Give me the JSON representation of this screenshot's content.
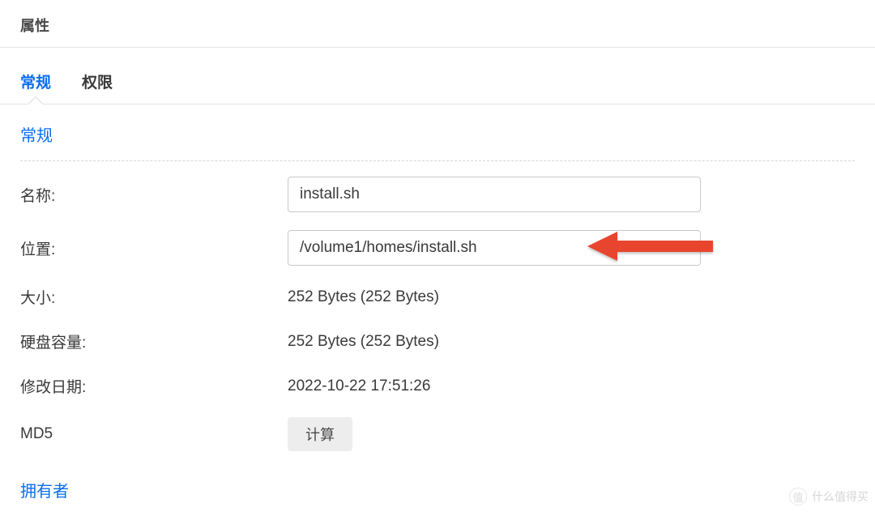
{
  "header": {
    "title": "属性"
  },
  "tabs": {
    "general": "常规",
    "permission": "权限"
  },
  "section": {
    "general_title": "常规",
    "owner_title": "拥有者"
  },
  "fields": {
    "name_label": "名称:",
    "name_value": "install.sh",
    "location_label": "位置:",
    "location_value": "/volume1/homes/install.sh",
    "size_label": "大小:",
    "size_value": "252 Bytes (252 Bytes)",
    "disk_label": "硬盘容量:",
    "disk_value": "252 Bytes (252 Bytes)",
    "modified_label": "修改日期:",
    "modified_value": "2022-10-22 17:51:26",
    "md5_label": "MD5",
    "md5_button": "计算"
  },
  "watermark": {
    "text": "什么值得买"
  }
}
